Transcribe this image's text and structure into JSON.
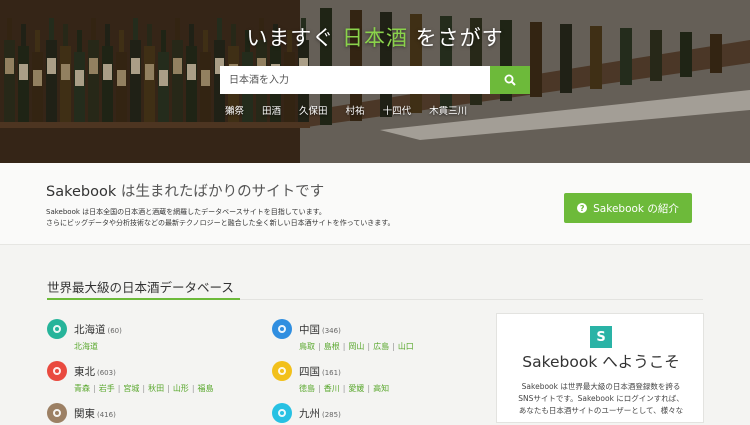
{
  "hero": {
    "title_before": "いますぐ ",
    "title_highlight": "日本酒",
    "title_after": " をさがす",
    "search_placeholder": "日本酒を入力",
    "search_button_icon": "search-icon",
    "popular": [
      "獺祭",
      "田酒",
      "久保田",
      "村祐",
      "十四代",
      "木貫三川"
    ]
  },
  "intro": {
    "brand": "Sakebook",
    "title_rest": " は生まれたばかりのサイトです",
    "desc_line1": "Sakebook は日本全国の日本酒と酒蔵を網羅したデータベースサイトを目指しています。",
    "desc_line2": "さらにビッグデータや分析技術などの最新テクノロジーと融合した全く新しい日本酒サイトを作っていきます。",
    "button_label": "Sakebook の紹介",
    "button_icon": "question-circle-icon"
  },
  "database": {
    "title": "世界最大級の日本酒データベース",
    "regions": [
      {
        "name": "北海道",
        "count": "(60)",
        "color": "#26b49a",
        "prefs": [
          "北海道"
        ]
      },
      {
        "name": "東北",
        "count": "(603)",
        "color": "#e94a3f",
        "prefs": [
          "青森",
          "岩手",
          "宮城",
          "秋田",
          "山形",
          "福島"
        ]
      },
      {
        "name": "関東",
        "count": "(416)",
        "color": "#9c8064",
        "prefs": []
      },
      {
        "name": "中国",
        "count": "(346)",
        "color": "#2f8ee0",
        "prefs": [
          "鳥取",
          "島根",
          "岡山",
          "広島",
          "山口"
        ]
      },
      {
        "name": "四国",
        "count": "(161)",
        "color": "#f2c01b",
        "prefs": [
          "徳島",
          "香川",
          "愛媛",
          "高知"
        ]
      },
      {
        "name": "九州",
        "count": "(285)",
        "color": "#27c1e3",
        "prefs": []
      }
    ]
  },
  "side": {
    "logo_letter": "S",
    "title": "Sakebook へようこそ",
    "text_line1": "Sakebook は世界最大級の日本酒登録数を誇る",
    "text_line2": "SNSサイトです。Sakebook にログインすれば、",
    "text_line3": "あなたも日本酒サイトのユーザーとして、様々な"
  }
}
